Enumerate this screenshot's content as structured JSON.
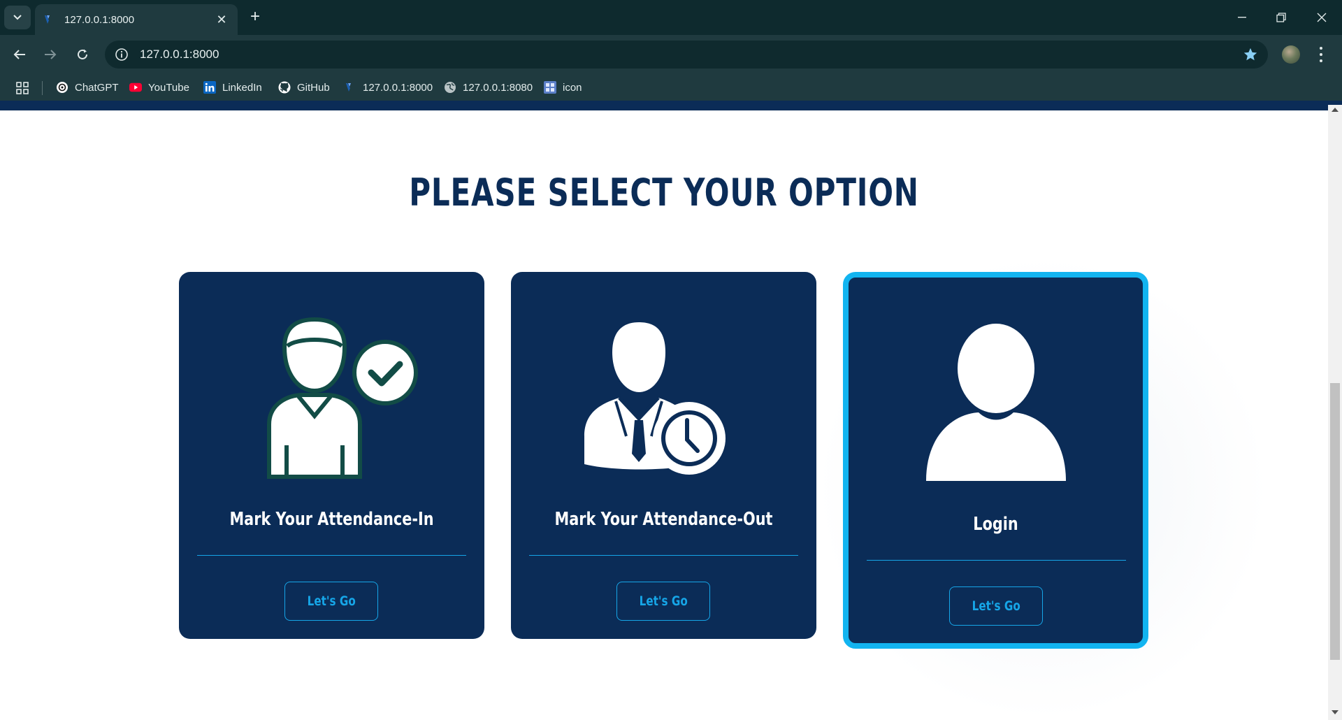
{
  "browser": {
    "tab": {
      "title": "127.0.0.1:8000"
    },
    "address": {
      "url": "127.0.0.1:8000"
    },
    "bookmarks": [
      {
        "label": "ChatGPT",
        "icon": "chatgpt-icon"
      },
      {
        "label": "YouTube",
        "icon": "youtube-icon"
      },
      {
        "label": "LinkedIn",
        "icon": "linkedin-icon"
      },
      {
        "label": "GitHub",
        "icon": "github-icon"
      },
      {
        "label": "127.0.0.1:8000",
        "icon": "site-icon"
      },
      {
        "label": "127.0.0.1:8080",
        "icon": "globe-icon"
      },
      {
        "label": "icon",
        "icon": "repo-icon"
      }
    ]
  },
  "page": {
    "title": "PLEASE SELECT YOUR OPTION",
    "cards": [
      {
        "label": "Mark Your Attendance-In",
        "button": "Let's Go",
        "icon": "user-check-icon"
      },
      {
        "label": "Mark Your Attendance-Out",
        "button": "Let's Go",
        "icon": "user-clock-icon"
      },
      {
        "label": "Login",
        "button": "Let's Go",
        "icon": "user-icon",
        "selected": true
      }
    ]
  },
  "colors": {
    "navy": "#0b2c57",
    "accent": "#16a6e8",
    "highlight_border": "#12b4f0",
    "chrome_dark": "#0e2a2e",
    "chrome_toolbar": "#1f3a3f"
  }
}
